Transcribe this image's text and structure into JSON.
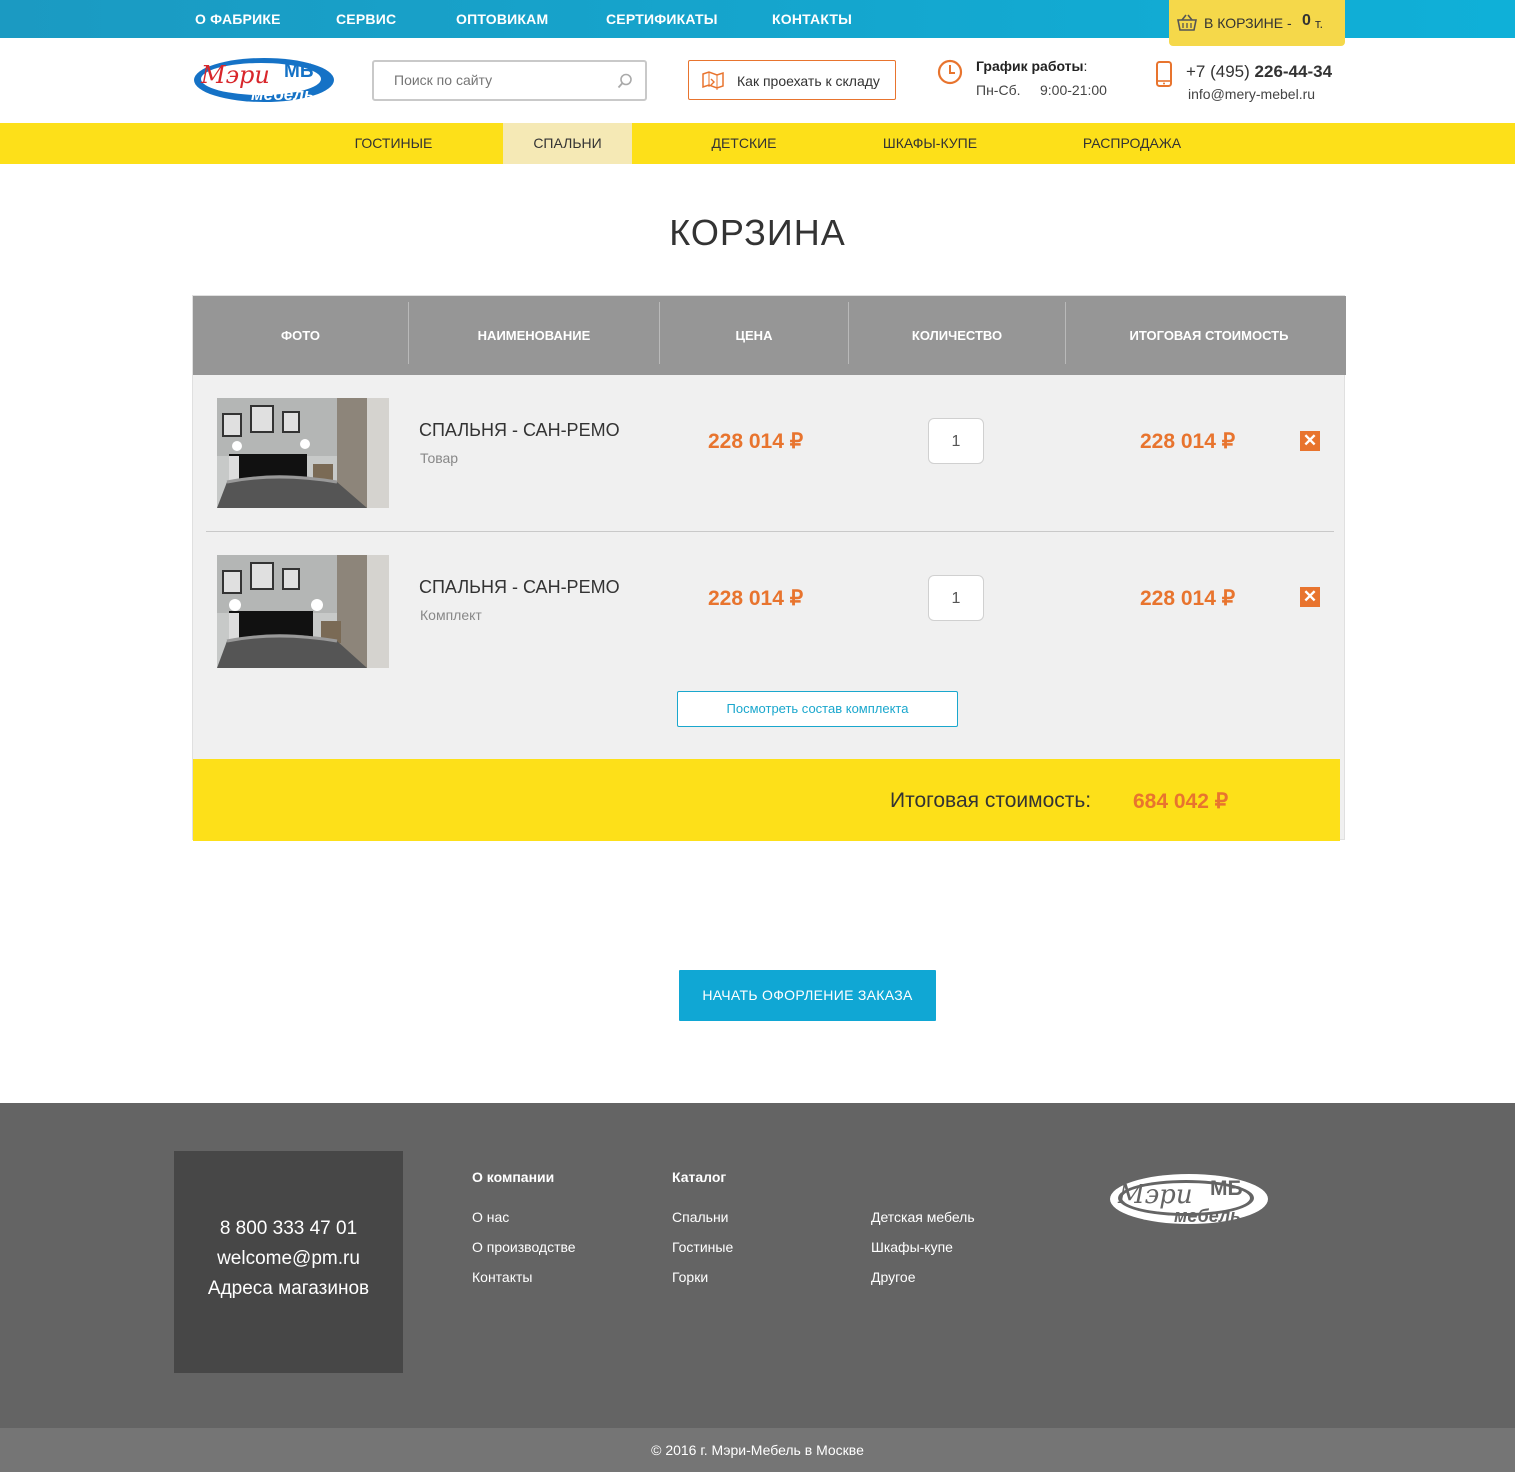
{
  "topnav": {
    "items": [
      {
        "label": "О ФАБРИКЕ"
      },
      {
        "label": "СЕРВИС"
      },
      {
        "label": "ОПТОВИКАМ"
      },
      {
        "label": "СЕРТИФИКАТЫ"
      },
      {
        "label": "КОНТАКТЫ"
      }
    ],
    "cart": {
      "label": "В КОРЗИНЕ  -",
      "count": "0",
      "unit": "т."
    }
  },
  "header": {
    "logo_text_top": "Мэри",
    "logo_text_bottom": "мебель",
    "logo_mark": "МБ",
    "search_placeholder": "Поиск по сайту",
    "route_label": "Как проехать к складу",
    "schedule_title": "График работы",
    "schedule_colon": ":",
    "schedule_days": "Пн-Сб.",
    "schedule_hours": "9:00-21:00",
    "phone_prefix": "+7 (495)",
    "phone_number": "226-44-34",
    "email": "info@mery-mebel.ru"
  },
  "mainnav": {
    "items": [
      {
        "label": "ГОСТИНЫЕ"
      },
      {
        "label": "СПАЛЬНИ"
      },
      {
        "label": "ДЕТСКИЕ"
      },
      {
        "label": "ШКАФЫ-КУПЕ"
      },
      {
        "label": "РАСПРОДАЖА"
      }
    ],
    "active": "СПАЛЬНИ"
  },
  "page": {
    "title": "КОРЗИНА"
  },
  "cart": {
    "columns": [
      "ФОТО",
      "НАИМЕНОВАНИЕ",
      "ЦЕНА",
      "КОЛИЧЕСТВО",
      "ИТОГОВАЯ СТОИМОСТЬ"
    ],
    "rows": [
      {
        "name": "СПАЛЬНЯ - САН-РЕМО",
        "type": "Товар",
        "price": "228 014 ₽",
        "qty": "1",
        "total": "228 014 ₽"
      },
      {
        "name": "СПАЛЬНЯ - САН-РЕМО",
        "type": "Комплект",
        "price": "228 014 ₽",
        "qty": "1",
        "total": "228 014 ₽"
      }
    ],
    "view_set_label": "Посмотреть состав комплекта",
    "total_label": "Итоговая стоимость:",
    "total_value": "684 042 ₽"
  },
  "order_button": "НАЧАТЬ ОФОРЛЕНИЕ ЗАКАЗА",
  "footer": {
    "contact": {
      "phone": "8 800 333 47 01",
      "email": "welcome@pm.ru",
      "addresses": "Адреса магазинов"
    },
    "company_head": "О компании",
    "company_links": [
      "О нас",
      "О производстве",
      "Контакты"
    ],
    "catalog_head": "Каталог",
    "catalog_links_1": [
      "Спальни",
      "Гостиные",
      "Горки"
    ],
    "catalog_links_2": [
      "Детская мебель",
      "Шкафы-купе",
      "Другое"
    ],
    "copyright": "© 2016 г. Мэри-Мебель в Москве"
  },
  "colors": {
    "accent_blue": "#10a7d4",
    "accent_yellow": "#fde019",
    "price_orange": "#e8742e",
    "footer_gray": "#646464"
  },
  "icons": [
    "basket-icon",
    "search-icon",
    "map-route-icon",
    "clock-icon",
    "phone-icon",
    "close-icon"
  ]
}
